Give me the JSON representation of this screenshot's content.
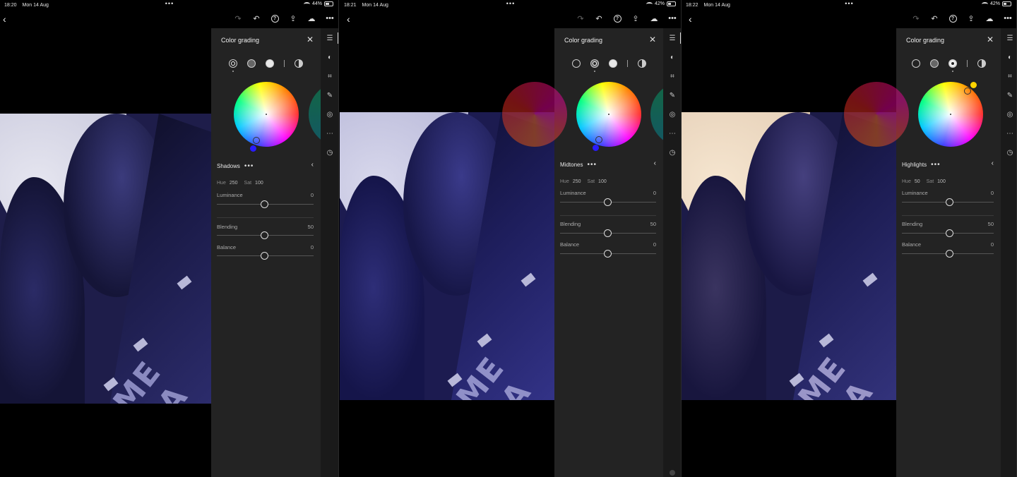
{
  "screens": [
    {
      "time": "18:20",
      "date": "Mon 14 Aug",
      "battery": "44%",
      "battery_level": 0.44,
      "panel_title": "Color grading",
      "active_mode": "shadows",
      "section": "Shadows",
      "hue_label": "Hue",
      "hue": "250",
      "sat_label": "Sat",
      "sat": "100",
      "luminance_label": "Luminance",
      "luminance": "0",
      "blending_label": "Blending",
      "blending": "50",
      "balance_label": "Balance",
      "balance": "0",
      "handle_color": "#2a1cff"
    },
    {
      "time": "18:21",
      "date": "Mon 14 Aug",
      "battery": "42%",
      "battery_level": 0.42,
      "panel_title": "Color grading",
      "active_mode": "midtones",
      "section": "Midtones",
      "hue_label": "Hue",
      "hue": "250",
      "sat_label": "Sat",
      "sat": "100",
      "luminance_label": "Luminance",
      "luminance": "0",
      "blending_label": "Blending",
      "blending": "50",
      "balance_label": "Balance",
      "balance": "0",
      "handle_color": "#2a1cff"
    },
    {
      "time": "18:22",
      "date": "Mon 14 Aug",
      "battery": "42%",
      "battery_level": 0.42,
      "panel_title": "Color grading",
      "active_mode": "highlights",
      "section": "Highlights",
      "hue_label": "Hue",
      "hue": "50",
      "sat_label": "Sat",
      "sat": "100",
      "luminance_label": "Luminance",
      "luminance": "0",
      "blending_label": "Blending",
      "blending": "50",
      "balance_label": "Balance",
      "balance": "0",
      "handle_color": "#ffd400"
    }
  ],
  "photo_sign_text": "ME GA",
  "colors": {
    "panel_bg": "#232323",
    "rail_bg": "#1a1a1a",
    "photo_shadow_tint": "#1e1d4a",
    "sky_cool": "#c8c8e0",
    "sky_warm": "#efdcc4"
  }
}
